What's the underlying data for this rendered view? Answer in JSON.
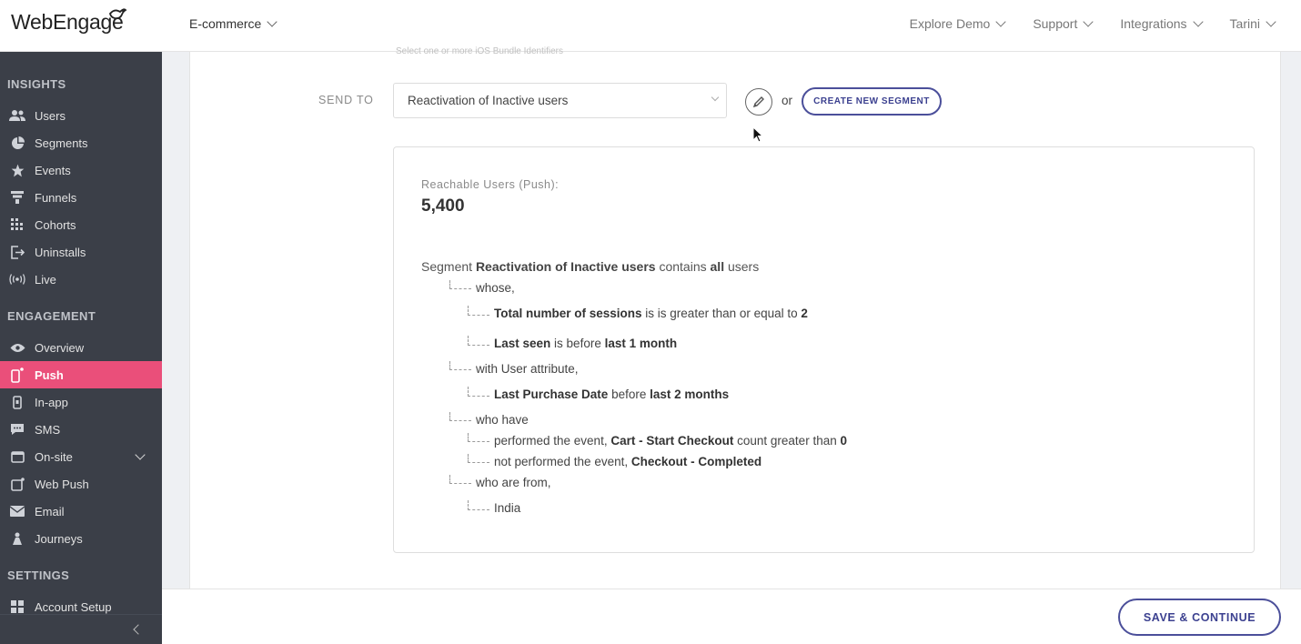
{
  "brand": {
    "name": "WebEngage",
    "accent": "#ea4f7a",
    "primary_button": "#3c4190"
  },
  "topbar": {
    "project": "E-commerce",
    "nav": [
      "Explore Demo",
      "Support",
      "Integrations",
      "Tarini"
    ]
  },
  "sidebar": {
    "sections": [
      {
        "title": "INSIGHTS",
        "items": [
          {
            "label": "Users",
            "icon": "users-icon"
          },
          {
            "label": "Segments",
            "icon": "pie-chart-icon"
          },
          {
            "label": "Events",
            "icon": "star-icon"
          },
          {
            "label": "Funnels",
            "icon": "funnel-icon"
          },
          {
            "label": "Cohorts",
            "icon": "grid-icon"
          },
          {
            "label": "Uninstalls",
            "icon": "exit-icon"
          },
          {
            "label": "Live",
            "icon": "broadcast-icon"
          }
        ]
      },
      {
        "title": "ENGAGEMENT",
        "items": [
          {
            "label": "Overview",
            "icon": "eye-icon"
          },
          {
            "label": "Push",
            "icon": "mobile-push-icon",
            "active": true
          },
          {
            "label": "In-app",
            "icon": "mobile-icon"
          },
          {
            "label": "SMS",
            "icon": "sms-icon"
          },
          {
            "label": "On-site",
            "icon": "browser-icon",
            "expandable": true
          },
          {
            "label": "Web Push",
            "icon": "web-push-icon"
          },
          {
            "label": "Email",
            "icon": "envelope-icon"
          },
          {
            "label": "Journeys",
            "icon": "flask-icon"
          }
        ]
      },
      {
        "title": "SETTINGS",
        "items": [
          {
            "label": "Account Setup",
            "icon": "grid-icon"
          }
        ]
      }
    ]
  },
  "form": {
    "faint_hint": "Select one or more iOS Bundle Identifiers",
    "send_to_label": "SEND TO",
    "segment_selected": "Reactivation of Inactive users",
    "or_text": "or",
    "create_segment_label": "CREATE NEW SEGMENT"
  },
  "summary": {
    "reachable_label": "Reachable Users (Push):",
    "reachable_count": "5,400",
    "desc_prefix": "Segment",
    "segment_name": "Reactivation of Inactive users",
    "desc_middle": "contains",
    "desc_all": "all",
    "desc_suffix": "users",
    "tree": {
      "whose": "whose,",
      "c1_attr": "Total number of sessions",
      "c1_op": "is is greater than or equal to",
      "c1_val": "2",
      "c2_attr": "Last seen",
      "c2_op": "is before",
      "c2_val": "last 1 month",
      "with_attr": "with User attribute,",
      "c3_attr": "Last Purchase Date",
      "c3_op": "before",
      "c3_val": "last 2 months",
      "who_have": "who have",
      "e1_pre": "performed the event,",
      "e1_name": "Cart - Start Checkout",
      "e1_op": "count greater than",
      "e1_val": "0",
      "e2_pre": "not performed the event,",
      "e2_name": "Checkout - Completed",
      "who_from": "who are from,",
      "country": "India"
    }
  },
  "footer": {
    "save_label": "SAVE & CONTINUE"
  }
}
